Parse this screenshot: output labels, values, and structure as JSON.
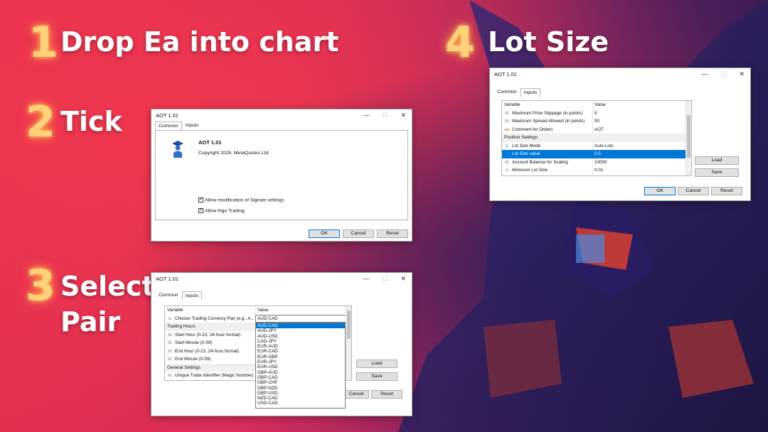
{
  "steps": [
    {
      "num": "1",
      "title": "Drop Ea into chart"
    },
    {
      "num": "2",
      "title": "Tick"
    },
    {
      "num": "3",
      "title_line1": "Select",
      "title_line2": "Pair"
    },
    {
      "num": "4",
      "title": "Lot Size"
    }
  ],
  "dialog_common": {
    "title": "AOT 1.01",
    "tabs": [
      "Common",
      "Inputs"
    ],
    "app_name": "AOT 1.01",
    "copyright": "Copyright 2025, MetaQuotes Ltd.",
    "checks": [
      "Allow modification of Signals settings",
      "Allow Algo Trading"
    ],
    "buttons": {
      "ok": "OK",
      "cancel": "Cancel",
      "reset": "Reset"
    }
  },
  "dialog_lot": {
    "title": "AOT 1.01",
    "tabs": [
      "Common",
      "Inputs"
    ],
    "headers": {
      "variable": "Variable",
      "value": "Value"
    },
    "rows": [
      {
        "icon": "01",
        "var": "Maximum Price Slippage (in points)",
        "val": "5"
      },
      {
        "icon": "01",
        "var": "Maximum Spread Allowed (in points)",
        "val": "50"
      },
      {
        "icon": "abc",
        "var": "Comment for Orders",
        "val": "AOT"
      },
      {
        "group": "Position Settings"
      },
      {
        "icon": "list",
        "var": "Lot Size Mode",
        "val": "Auto Lots"
      },
      {
        "icon": "",
        "var": "Lot Size value",
        "val": "0.5",
        "selected": true
      },
      {
        "icon": "01",
        "var": "Account Balance for Scaling",
        "val": "10000"
      },
      {
        "icon": "½",
        "var": "Minimum Lot Size",
        "val": "0.01"
      }
    ],
    "buttons": {
      "load": "Load",
      "save": "Save",
      "ok": "OK",
      "cancel": "Cancel",
      "reset": "Reset"
    }
  },
  "dialog_pair": {
    "title": "AOT 1.01",
    "tabs": [
      "Common",
      "Inputs"
    ],
    "headers": {
      "variable": "Variable",
      "value": "Value"
    },
    "rows": [
      {
        "icon": "list",
        "var": "Choose Trading Currency Pair (e.g., A...",
        "val": "AUD-CAD",
        "dropdown": true
      },
      {
        "group": "Trading Hours"
      },
      {
        "icon": "01",
        "var": "Start Hour (0-23, 24-hour format)",
        "val": ""
      },
      {
        "icon": "01",
        "var": "Start Minute (0-59)",
        "val": ""
      },
      {
        "icon": "01",
        "var": "End Hour (0-23, 24-hour format)",
        "val": ""
      },
      {
        "icon": "01",
        "var": "End Minute (0-59)",
        "val": ""
      },
      {
        "group": "General Settings"
      },
      {
        "icon": "01",
        "var": "Unique Trade Identifier (Magic Number)",
        "val": ""
      }
    ],
    "pair_options": [
      "AUD-CAD",
      "AUD-JPY",
      "AUD-USD",
      "CAD-JPY",
      "EUR-AUD",
      "EUR-CAD",
      "EUR-GBP",
      "EUR-JPY",
      "EUR-USD",
      "GBP-AUD",
      "GBP-CAD",
      "GBP-CHF",
      "GBP-NZD",
      "GBP-USD",
      "NZD-CAD",
      "USD-CAD"
    ],
    "selected_pair": "AUD-CAD",
    "buttons": {
      "load": "Load",
      "save": "Save",
      "cancel": "Cancel",
      "reset": "Reset"
    }
  }
}
